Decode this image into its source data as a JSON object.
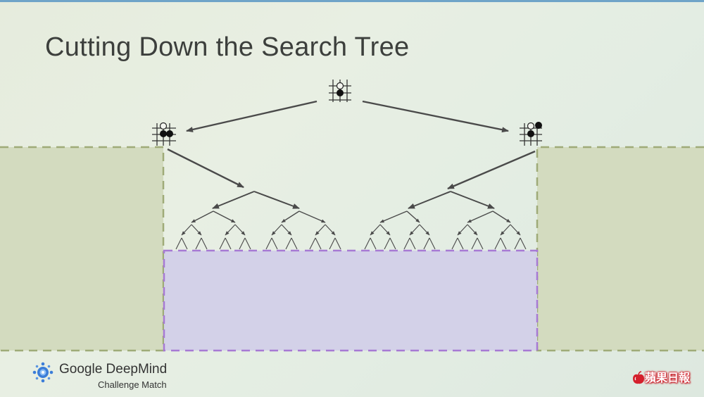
{
  "slide": {
    "title": "Cutting Down the Search Tree"
  },
  "logo": {
    "name": "Google DeepMind",
    "subtitle": "Challenge Match",
    "icon": "deepmind-logo-icon"
  },
  "watermark": {
    "text": "蘋果日報",
    "icon": "apple-icon"
  },
  "colors": {
    "background": "#e6ecdd",
    "pruned_region": "#d3dbbf",
    "pruned_border": "#9fab78",
    "evaluated_region": "#d3d1e8",
    "evaluated_border": "#a77ad4",
    "arrow": "#4a4a4a",
    "watermark": "#d4202c"
  }
}
